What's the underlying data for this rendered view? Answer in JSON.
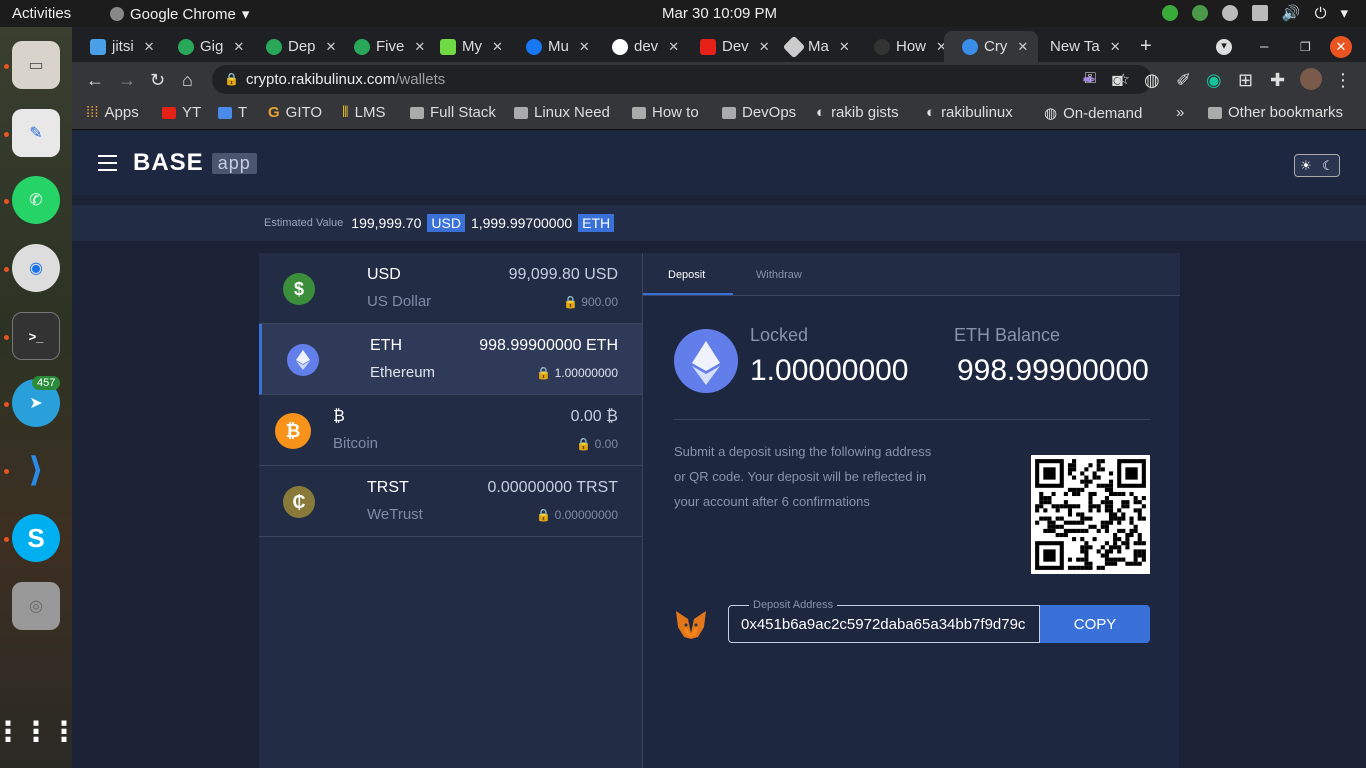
{
  "os": {
    "activities": "Activities",
    "app_name": "Google Chrome",
    "clock": "Mar 30  10:09 PM",
    "telegram_badge": "457"
  },
  "browser": {
    "tabs": [
      "jitsi",
      "Gig",
      "Dep",
      "Five",
      "My",
      "Mu",
      "dev",
      "Dev",
      "Ma",
      "How",
      "Cry",
      "New Ta"
    ],
    "url_host": "crypto.rakibulinux.com",
    "url_path": "/wallets",
    "bookmarks": [
      "Apps",
      "YT",
      "T",
      "GITO",
      "LMS",
      "Full Stack",
      "Linux Need",
      "How to",
      "DevOps",
      "rakib gists",
      "rakibulinux",
      "On-demand",
      "Other bookmarks"
    ],
    "more": "»"
  },
  "app": {
    "brand": "BASE",
    "brand_tag": "app",
    "estimated_label": "Estimated Value",
    "estimated_usd": "199,999.70",
    "usd_chip": "USD",
    "estimated_eth": "1,999.99700000",
    "eth_chip": "ETH"
  },
  "wallets": [
    {
      "symbol": "USD",
      "name": "US Dollar",
      "balance": "99,099.80 USD",
      "locked": "900.00",
      "icon": "$",
      "color": "#3b8e3a"
    },
    {
      "symbol": "ETH",
      "name": "Ethereum",
      "balance": "998.99900000 ETH",
      "locked": "1.00000000",
      "icon": "eth",
      "color": "#627eea"
    },
    {
      "symbol": "₿",
      "name": "Bitcoin",
      "balance": "0.00 ₿",
      "locked": "0.00",
      "icon": "₿",
      "color": "#f7931a"
    },
    {
      "symbol": "TRST",
      "name": "WeTrust",
      "balance": "0.00000000 TRST",
      "locked": "0.00000000",
      "icon": "₵",
      "color": "#8a7a3a"
    }
  ],
  "panel": {
    "tab_deposit": "Deposit",
    "tab_withdraw": "Withdraw",
    "locked_label": "Locked",
    "locked_value": "1.00000000",
    "balance_label": "ETH Balance",
    "balance_value": "998.99900000",
    "description": "Submit a deposit using the following address or QR code. Your deposit will be reflected in your account after 6 confirmations",
    "address_label": "Deposit Address",
    "address": "0x451b6a9ac2c5972daba65a34bb7f9d79c",
    "copy_label": "COPY"
  }
}
